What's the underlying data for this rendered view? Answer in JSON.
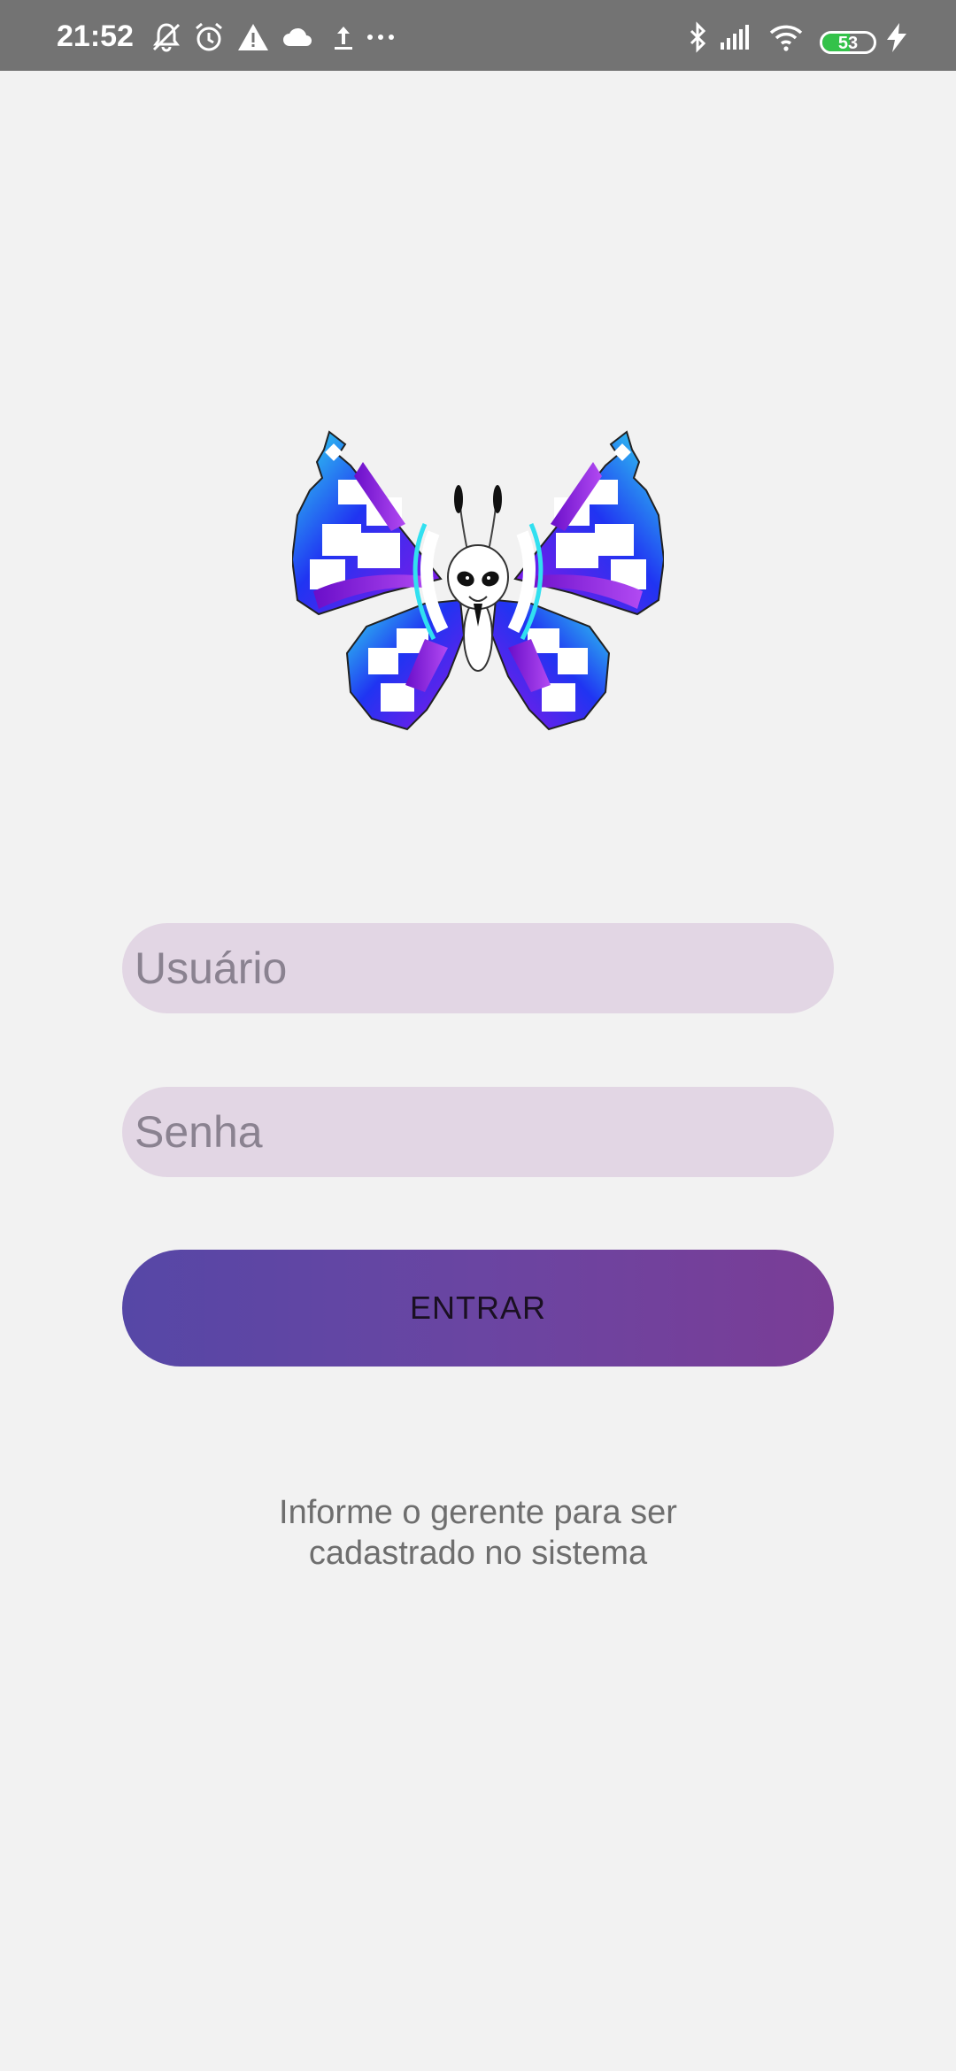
{
  "status_bar": {
    "time": "21:52",
    "battery_level": "53",
    "battery_fraction": 0.53,
    "icons": [
      "muted-bell-icon",
      "alarm-icon",
      "warning-icon",
      "cloud-icon",
      "upload-icon",
      "more-dots-icon",
      "bluetooth-icon",
      "signal-icon",
      "wifi-icon",
      "battery-icon",
      "charging-icon"
    ]
  },
  "logo": {
    "icon": "butterfly-logo",
    "colors": [
      "#1e22f0",
      "#8c16e6",
      "#2fd6ea",
      "#ffffff"
    ]
  },
  "form": {
    "username_placeholder": "Usuário",
    "password_placeholder": "Senha",
    "username_value": "",
    "password_value": "",
    "login_label": "ENTRAR"
  },
  "info": {
    "line1": "Informe o gerente para ser",
    "line2": "cadastrado no sistema"
  },
  "colors": {
    "background": "#f2f2f2",
    "status_bar": "#737373",
    "input_background": "#e2d6e4",
    "button_gradient_start": "#5647a6",
    "button_gradient_end": "#7a3d96",
    "battery_fill": "#34c24a"
  }
}
